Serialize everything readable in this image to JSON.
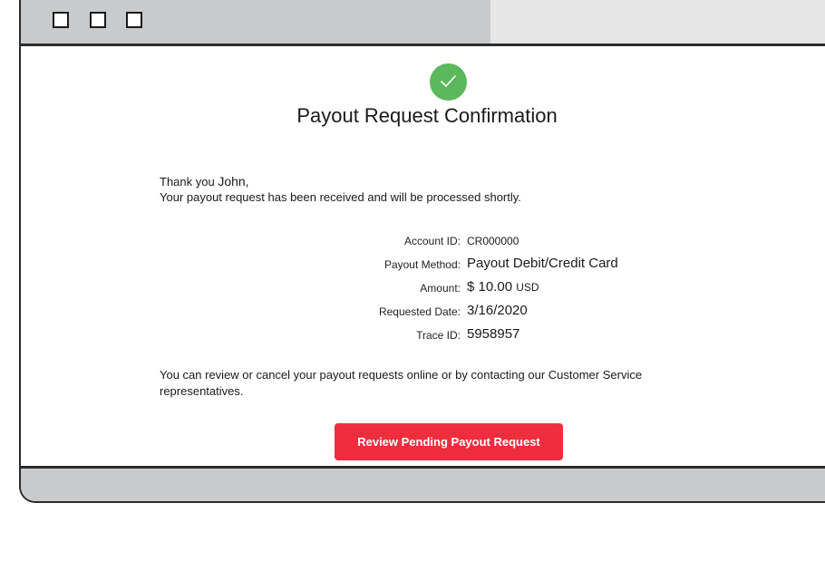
{
  "window": {
    "controls": [
      "square-icon",
      "square-icon",
      "square-icon"
    ]
  },
  "confirmation": {
    "status_icon": "check-circle-icon",
    "status_color": "#5cb85c",
    "title": "Payout Request Confirmation",
    "greeting_prefix": "Thank you",
    "customer_name": "John,",
    "message": "Your payout request has been received and will be processed shortly."
  },
  "details": {
    "account_id_label": "Account ID:",
    "account_id_value": "CR000000",
    "payout_method_label": "Payout Method:",
    "payout_method_value": "Payout Debit/Credit Card",
    "amount_label": "Amount:",
    "amount_value": "$ 10.00",
    "amount_currency": "USD",
    "requested_date_label": "Requested Date:",
    "requested_date_value": "3/16/2020",
    "trace_id_label": "Trace ID:",
    "trace_id_value": "5958957"
  },
  "note": "You can review or cancel your payout requests online or by contacting our Customer Service representatives.",
  "cta": {
    "label": "Review Pending Payout Request",
    "color": "#ee2e3f"
  }
}
